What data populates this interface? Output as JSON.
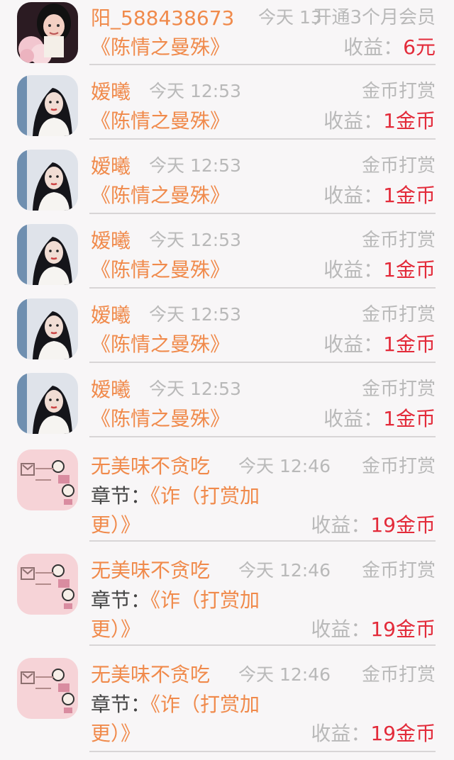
{
  "colors": {
    "name": "#f08a4b",
    "muted": "#b9b9b9",
    "amount": "#e32b3a",
    "divider": "#d8d5d6"
  },
  "rows": [
    {
      "name": "阳_588438673",
      "time": "今天 13",
      "type": "开通3个月会员",
      "book": "《陈情之曼殊》",
      "earn_label": "收益：",
      "earn_value": "6元",
      "avatar": "woman-with-roses-avatar"
    },
    {
      "name": "嫒曦",
      "time": "今天 12:53",
      "type": "金币打赏",
      "book": "《陈情之曼殊》",
      "earn_label": "收益：",
      "earn_value": "1金币",
      "avatar": "woman-portrait-avatar"
    },
    {
      "name": "嫒曦",
      "time": "今天 12:53",
      "type": "金币打赏",
      "book": "《陈情之曼殊》",
      "earn_label": "收益：",
      "earn_value": "1金币",
      "avatar": "woman-portrait-avatar"
    },
    {
      "name": "嫒曦",
      "time": "今天 12:53",
      "type": "金币打赏",
      "book": "《陈情之曼殊》",
      "earn_label": "收益：",
      "earn_value": "1金币",
      "avatar": "woman-portrait-avatar"
    },
    {
      "name": "嫒曦",
      "time": "今天 12:53",
      "type": "金币打赏",
      "book": "《陈情之曼殊》",
      "earn_label": "收益：",
      "earn_value": "1金币",
      "avatar": "woman-portrait-avatar"
    },
    {
      "name": "嫒曦",
      "time": "今天 12:53",
      "type": "金币打赏",
      "book": "《陈情之曼殊》",
      "earn_label": "收益：",
      "earn_value": "1金币",
      "avatar": "woman-portrait-avatar"
    },
    {
      "name": "无美味不贪吃",
      "time": "今天 12:46",
      "type": "金币打赏",
      "chapter_label": "章节：",
      "chapter_line1": "《诈（打赏加",
      "chapter_line2": "更）》",
      "earn_label": "收益：",
      "earn_value": "19金币",
      "avatar": "pink-cartoon-avatar"
    },
    {
      "name": "无美味不贪吃",
      "time": "今天 12:46",
      "type": "金币打赏",
      "chapter_label": "章节：",
      "chapter_line1": "《诈（打赏加",
      "chapter_line2": "更）》",
      "earn_label": "收益：",
      "earn_value": "19金币",
      "avatar": "pink-cartoon-avatar"
    },
    {
      "name": "无美味不贪吃",
      "time": "今天 12:46",
      "type": "金币打赏",
      "chapter_label": "章节：",
      "chapter_line1": "《诈（打赏加",
      "chapter_line2": "更）》",
      "earn_label": "收益：",
      "earn_value": "19金币",
      "avatar": "pink-cartoon-avatar"
    }
  ]
}
